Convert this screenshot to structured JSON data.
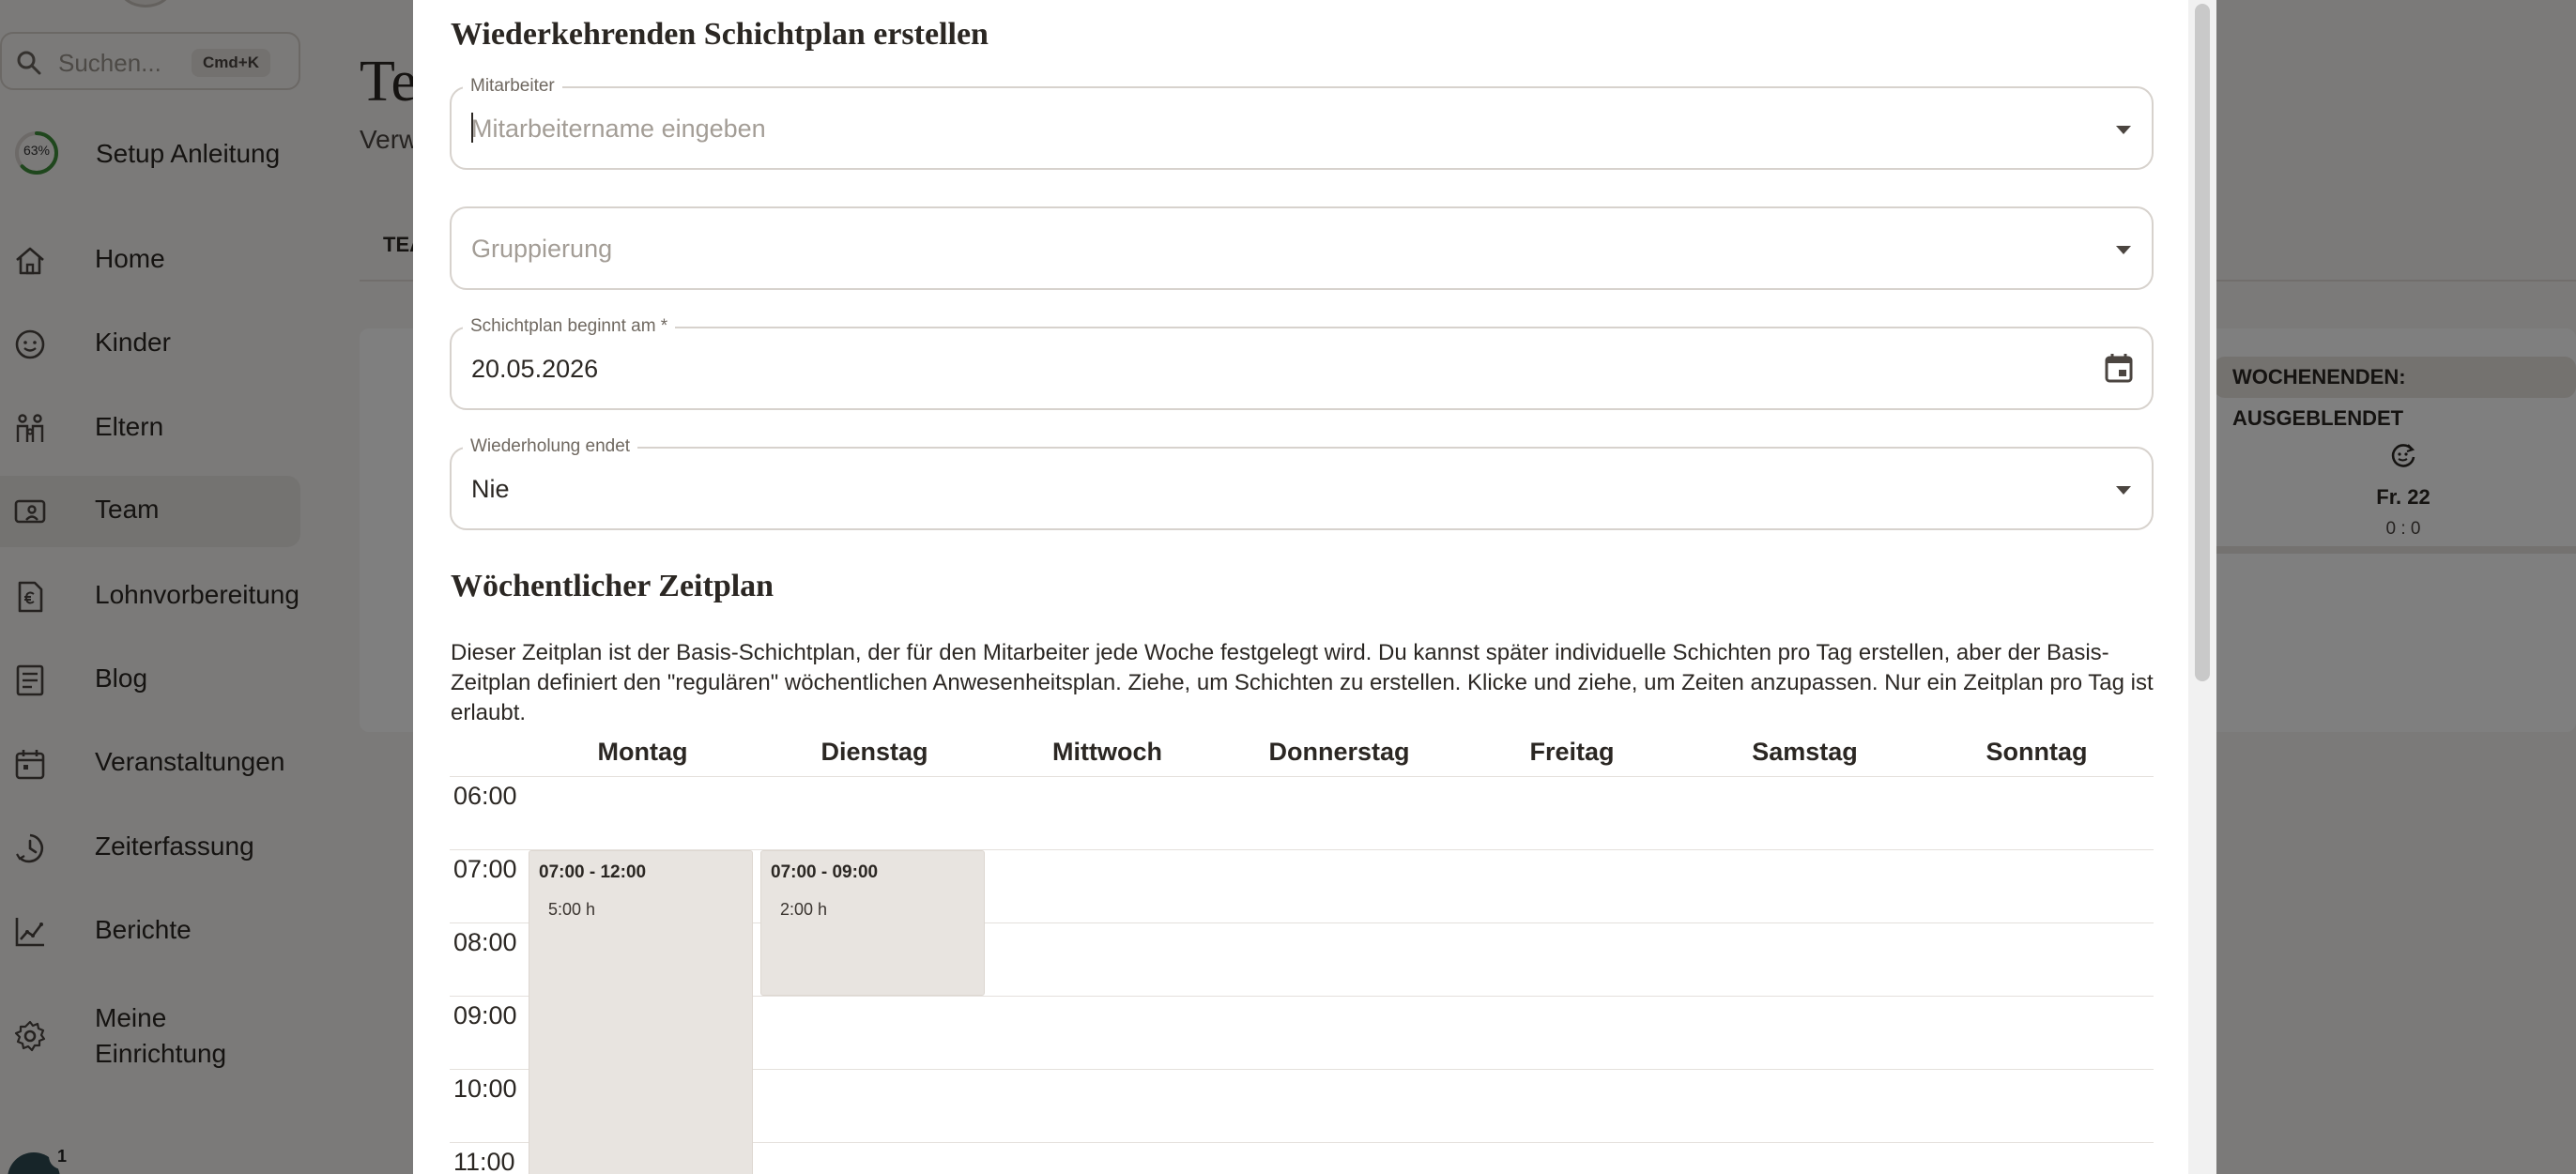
{
  "sidebar": {
    "search_placeholder": "Suchen...",
    "search_shortcut": "Cmd+K",
    "setup_progress": "63%",
    "setup_label": "Setup Anleitung",
    "items": [
      {
        "label": "Home",
        "icon": "home-icon"
      },
      {
        "label": "Kinder",
        "icon": "child-face-icon"
      },
      {
        "label": "Eltern",
        "icon": "parents-icon"
      },
      {
        "label": "Team",
        "icon": "team-badge-icon"
      },
      {
        "label": "Lohnvorbereitung",
        "icon": "payroll-euro-icon"
      },
      {
        "label": "Blog",
        "icon": "blog-icon"
      },
      {
        "label": "Veranstaltungen",
        "icon": "calendar-icon"
      },
      {
        "label": "Zeiterfassung",
        "icon": "clock-icon"
      },
      {
        "label": "Berichte",
        "icon": "chart-icon"
      },
      {
        "label": "Meine Einrichtung",
        "icon": "gear-icon"
      }
    ],
    "active_item": "Team",
    "notification_count": "1"
  },
  "page": {
    "title_fragment": "Te",
    "subtitle_fragment": "Verw",
    "tab_fragment": "TEA",
    "weekend_chip": "WOCHENENDEN: AUSGEBLENDET",
    "friday_label": "Fr. 22",
    "friday_value": "0 : 0"
  },
  "dialog": {
    "title": "Wiederkehrenden Schichtplan erstellen",
    "employee": {
      "label": "Mitarbeiter",
      "placeholder": "Mitarbeitername eingeben"
    },
    "grouping": {
      "placeholder": "Gruppierung"
    },
    "start": {
      "label": "Schichtplan beginnt am *",
      "value": "20.05.2026"
    },
    "repeat_end": {
      "label": "Wiederholung endet",
      "value": "Nie"
    },
    "weekly_title": "Wöchentlicher Zeitplan",
    "weekly_description": "Dieser Zeitplan ist der Basis-Schichtplan, der für den Mitarbeiter jede Woche festgelegt wird. Du kannst später individuelle Schichten pro Tag erstellen, aber der Basis-Zeitplan definiert den \"regulären\" wöchentlichen Anwesenheitsplan. Ziehe, um Schichten zu erstellen. Klicke und ziehe, um Zeiten anzupassen. Nur ein Zeitplan pro Tag ist erlaubt.",
    "days": [
      "Montag",
      "Dienstag",
      "Mittwoch",
      "Donnerstag",
      "Freitag",
      "Samstag",
      "Sonntag"
    ],
    "hours": [
      "06:00",
      "07:00",
      "08:00",
      "09:00",
      "10:00",
      "11:00"
    ],
    "shifts": [
      {
        "day": "Montag",
        "time": "07:00 - 12:00",
        "duration": "5:00 h"
      },
      {
        "day": "Dienstag",
        "time": "07:00 - 09:00",
        "duration": "2:00 h"
      }
    ]
  },
  "colors": {
    "backdrop": "#000000",
    "shift_fill": "#e8e4e0",
    "text": "#2b2723",
    "setup_ring": "#3f8f3a"
  }
}
